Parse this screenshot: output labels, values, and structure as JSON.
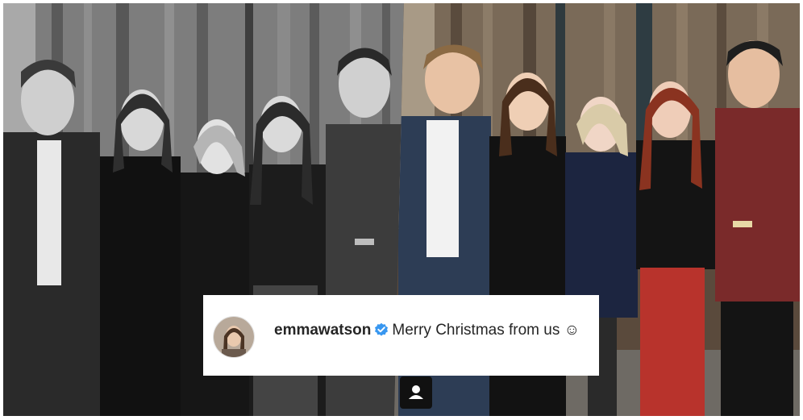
{
  "post": {
    "username": "emmawatson",
    "verified": true,
    "caption": "Merry Christmas from us",
    "emoji": "☺"
  },
  "icons": {
    "verified": "verified-badge-icon",
    "profile": "user-profile-icon"
  },
  "colors": {
    "verified_blue": "#3897f0",
    "text": "#262626"
  }
}
